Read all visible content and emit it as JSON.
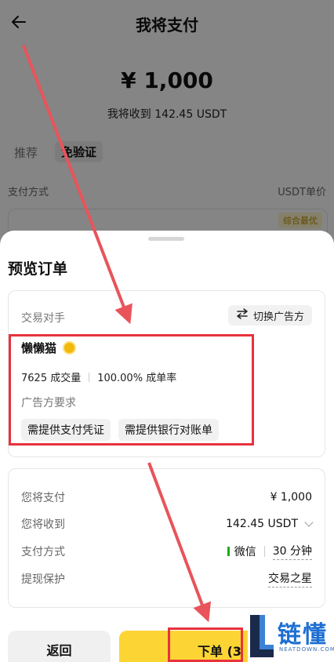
{
  "background": {
    "nav_title": "我将支付",
    "amount": "¥ 1,000",
    "receive_text": "我将收到 142.45 USDT",
    "tabs": [
      "推荐",
      "免验证"
    ],
    "col_pay_method": "支付方式",
    "col_price": "USDT单价",
    "best_badge": "综合最优"
  },
  "sheet": {
    "title": "预览订单",
    "counterparty": {
      "label": "交易对手",
      "switch_label": "切换广告方",
      "merchant_name": "懒懒猫",
      "volume": "7625 成交量",
      "completion": "100.00% 成单率",
      "requirements_label": "广告方要求",
      "requirements": [
        "需提供支付凭证",
        "需提供银行对账单"
      ]
    },
    "details": {
      "pay_label": "您将支付",
      "pay_value": "¥ 1,000",
      "receive_label": "您将收到",
      "receive_value": "142.45 USDT",
      "method_label": "支付方式",
      "method_value": "微信",
      "method_time": "30 分钟",
      "protection_label": "提现保护",
      "protection_value": "交易之星"
    },
    "buttons": {
      "back": "返回",
      "order": "下单 (3"
    }
  },
  "watermark": {
    "text": "链懂",
    "sub": "NEATDOWN.COM"
  },
  "colors": {
    "accent": "#fcd535",
    "highlight": "#e8323c",
    "wechat": "#1aad19"
  }
}
